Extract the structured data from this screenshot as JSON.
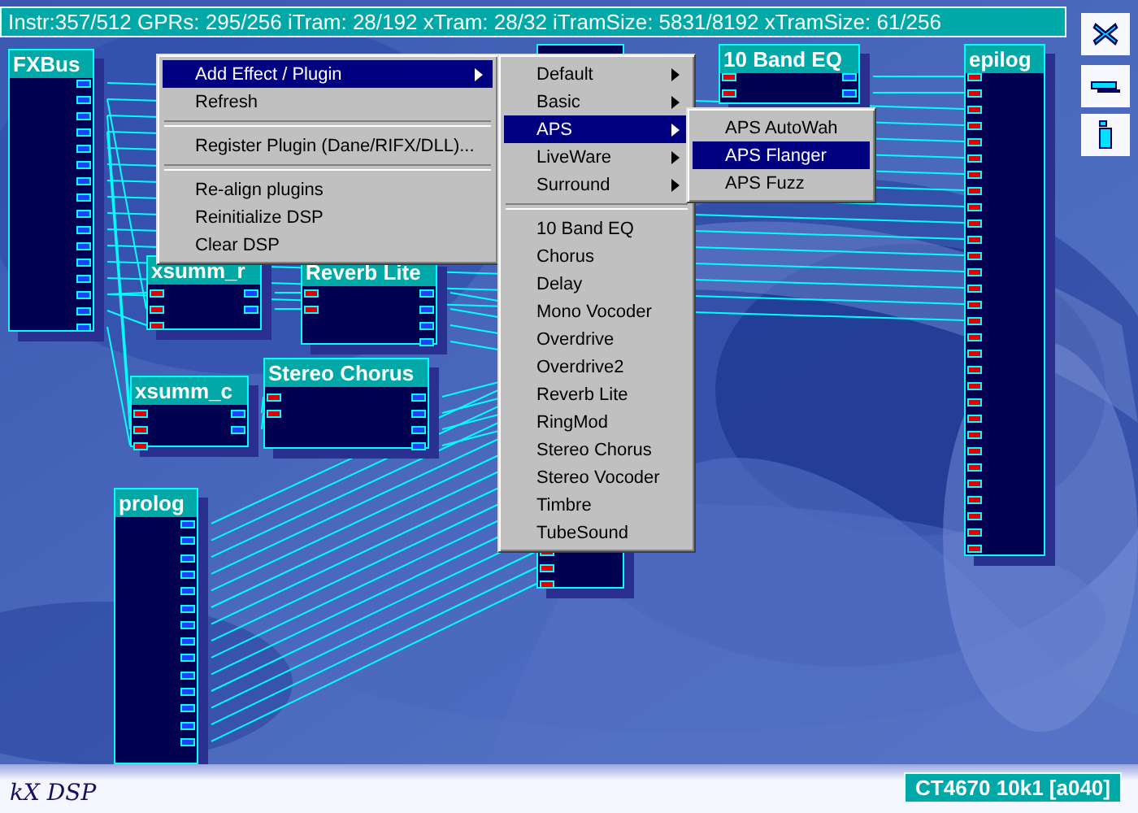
{
  "status_bar": {
    "text": "Instr:357/512 GPRs: 295/256 iTram: 28/192 xTram: 28/32 iTramSize: 5831/8192 xTramSize: 61/256"
  },
  "toolbar_buttons": [
    {
      "kind": "close"
    },
    {
      "kind": "minimize"
    },
    {
      "kind": "info"
    }
  ],
  "plugins": [
    {
      "kind": "titled",
      "name": "FXBus"
    },
    {
      "kind": "titled",
      "name": "xsumm_r"
    },
    {
      "kind": "titled",
      "name": "Reverb Lite"
    },
    {
      "kind": "titled",
      "name": "xsumm_c"
    },
    {
      "kind": "titled",
      "name": "Stereo Chorus"
    },
    {
      "kind": "titled",
      "name": "prolog"
    },
    {
      "kind": "covered"
    },
    {
      "kind": "titled",
      "name": "10 Band EQ"
    },
    {
      "kind": "titled",
      "name": "epilog"
    }
  ],
  "context_menu": {
    "items": [
      {
        "kind": "item",
        "label": "Add Effect / Plugin",
        "submenu": true,
        "selected": true
      },
      {
        "kind": "item",
        "label": "Refresh",
        "submenu": false,
        "selected": false
      },
      {
        "kind": "separator"
      },
      {
        "kind": "item",
        "label": "Register Plugin (Dane/RIFX/DLL)...",
        "submenu": false,
        "selected": false
      },
      {
        "kind": "separator"
      },
      {
        "kind": "item",
        "label": "Re-align plugins",
        "submenu": false,
        "selected": false
      },
      {
        "kind": "item",
        "label": "Reinitialize DSP",
        "submenu": false,
        "selected": false
      },
      {
        "kind": "item",
        "label": "Clear DSP",
        "submenu": false,
        "selected": false
      }
    ]
  },
  "plugin_menu": {
    "items": [
      {
        "kind": "item",
        "label": "Default",
        "submenu": true,
        "selected": false
      },
      {
        "kind": "item",
        "label": "Basic",
        "submenu": true,
        "selected": false
      },
      {
        "kind": "item",
        "label": "APS",
        "submenu": true,
        "selected": true
      },
      {
        "kind": "item",
        "label": "LiveWare",
        "submenu": true,
        "selected": false
      },
      {
        "kind": "item",
        "label": "Surround",
        "submenu": true,
        "selected": false
      },
      {
        "kind": "separator"
      },
      {
        "kind": "item",
        "label": "10 Band EQ",
        "submenu": false,
        "selected": false
      },
      {
        "kind": "item",
        "label": "Chorus",
        "submenu": false,
        "selected": false
      },
      {
        "kind": "item",
        "label": "Delay",
        "submenu": false,
        "selected": false
      },
      {
        "kind": "item",
        "label": "Mono Vocoder",
        "submenu": false,
        "selected": false
      },
      {
        "kind": "item",
        "label": "Overdrive",
        "submenu": false,
        "selected": false
      },
      {
        "kind": "item",
        "label": "Overdrive2",
        "submenu": false,
        "selected": false
      },
      {
        "kind": "item",
        "label": "Reverb Lite",
        "submenu": false,
        "selected": false
      },
      {
        "kind": "item",
        "label": "RingMod",
        "submenu": false,
        "selected": false
      },
      {
        "kind": "item",
        "label": "Stereo Chorus",
        "submenu": false,
        "selected": false
      },
      {
        "kind": "item",
        "label": "Stereo Vocoder",
        "submenu": false,
        "selected": false
      },
      {
        "kind": "item",
        "label": "Timbre",
        "submenu": false,
        "selected": false
      },
      {
        "kind": "item",
        "label": "TubeSound",
        "submenu": false,
        "selected": false
      }
    ]
  },
  "aps_menu": {
    "items": [
      {
        "kind": "item",
        "label": "APS AutoWah",
        "submenu": false,
        "selected": false
      },
      {
        "kind": "item",
        "label": "APS Flanger",
        "submenu": false,
        "selected": true
      },
      {
        "kind": "item",
        "label": "APS Fuzz",
        "submenu": false,
        "selected": false
      }
    ]
  },
  "footer": {
    "logo": "kX DSP",
    "device": "CT4670 10k1 [a040]"
  }
}
